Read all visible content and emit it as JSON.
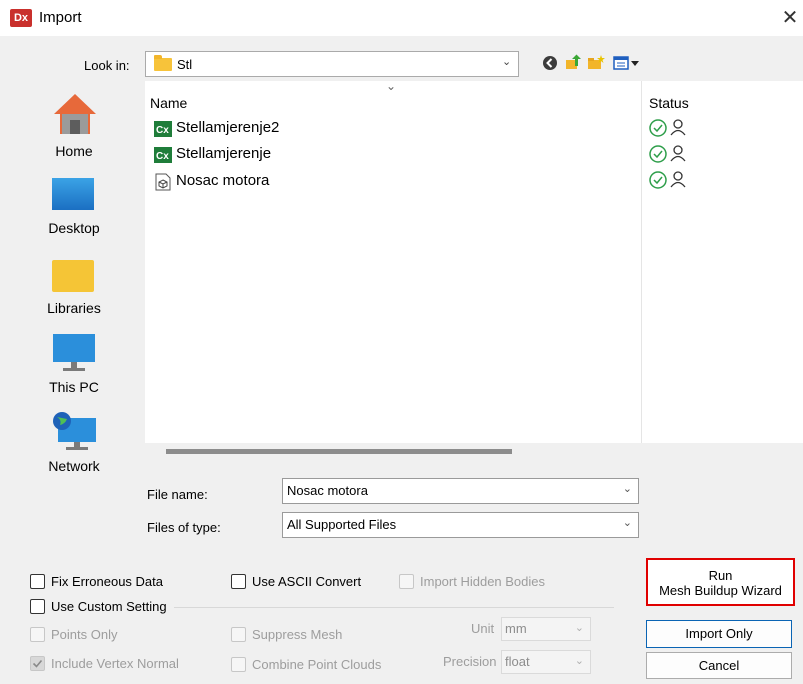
{
  "window": {
    "app_logo": "Dx",
    "title": "Import",
    "close_glyph": "✕"
  },
  "lookin": {
    "label": "Look in:",
    "value": "Stl"
  },
  "places": [
    {
      "id": "home",
      "label": "Home"
    },
    {
      "id": "desktop",
      "label": "Desktop"
    },
    {
      "id": "libraries",
      "label": "Libraries"
    },
    {
      "id": "thispc",
      "label": "This PC"
    },
    {
      "id": "network",
      "label": "Network"
    }
  ],
  "filelist": {
    "col_name": "Name",
    "col_status": "Status",
    "files": [
      {
        "name": "Stellamjerenje2",
        "icon": "cx-document-icon"
      },
      {
        "name": "Stellamjerenje",
        "icon": "cx-document-icon"
      },
      {
        "name": "Nosac motora",
        "icon": "stl-file-icon"
      }
    ]
  },
  "filename": {
    "label": "File name:",
    "value": "Nosac motora"
  },
  "filetype": {
    "label": "Files of type:",
    "value": "All Supported Files"
  },
  "options": {
    "fix_erroneous": "Fix Erroneous Data",
    "use_ascii": "Use ASCII Convert",
    "import_hidden": "Import Hidden Bodies",
    "use_custom": "Use Custom Setting",
    "points_only": "Points Only",
    "suppress_mesh": "Suppress Mesh",
    "include_vertex_normal": "Include Vertex Normal",
    "combine_point_clouds": "Combine Point Clouds",
    "unit_label": "Unit",
    "unit_value": "mm",
    "precision_label": "Precision",
    "precision_value": "float"
  },
  "buttons": {
    "run_line1": "Run",
    "run_line2": "Mesh Buildup Wizard",
    "import_only": "Import Only",
    "cancel": "Cancel"
  },
  "colors": {
    "accent_red": "#e00000",
    "folder_yellow": "#f7c33a",
    "check_green": "#2e9e4a"
  }
}
